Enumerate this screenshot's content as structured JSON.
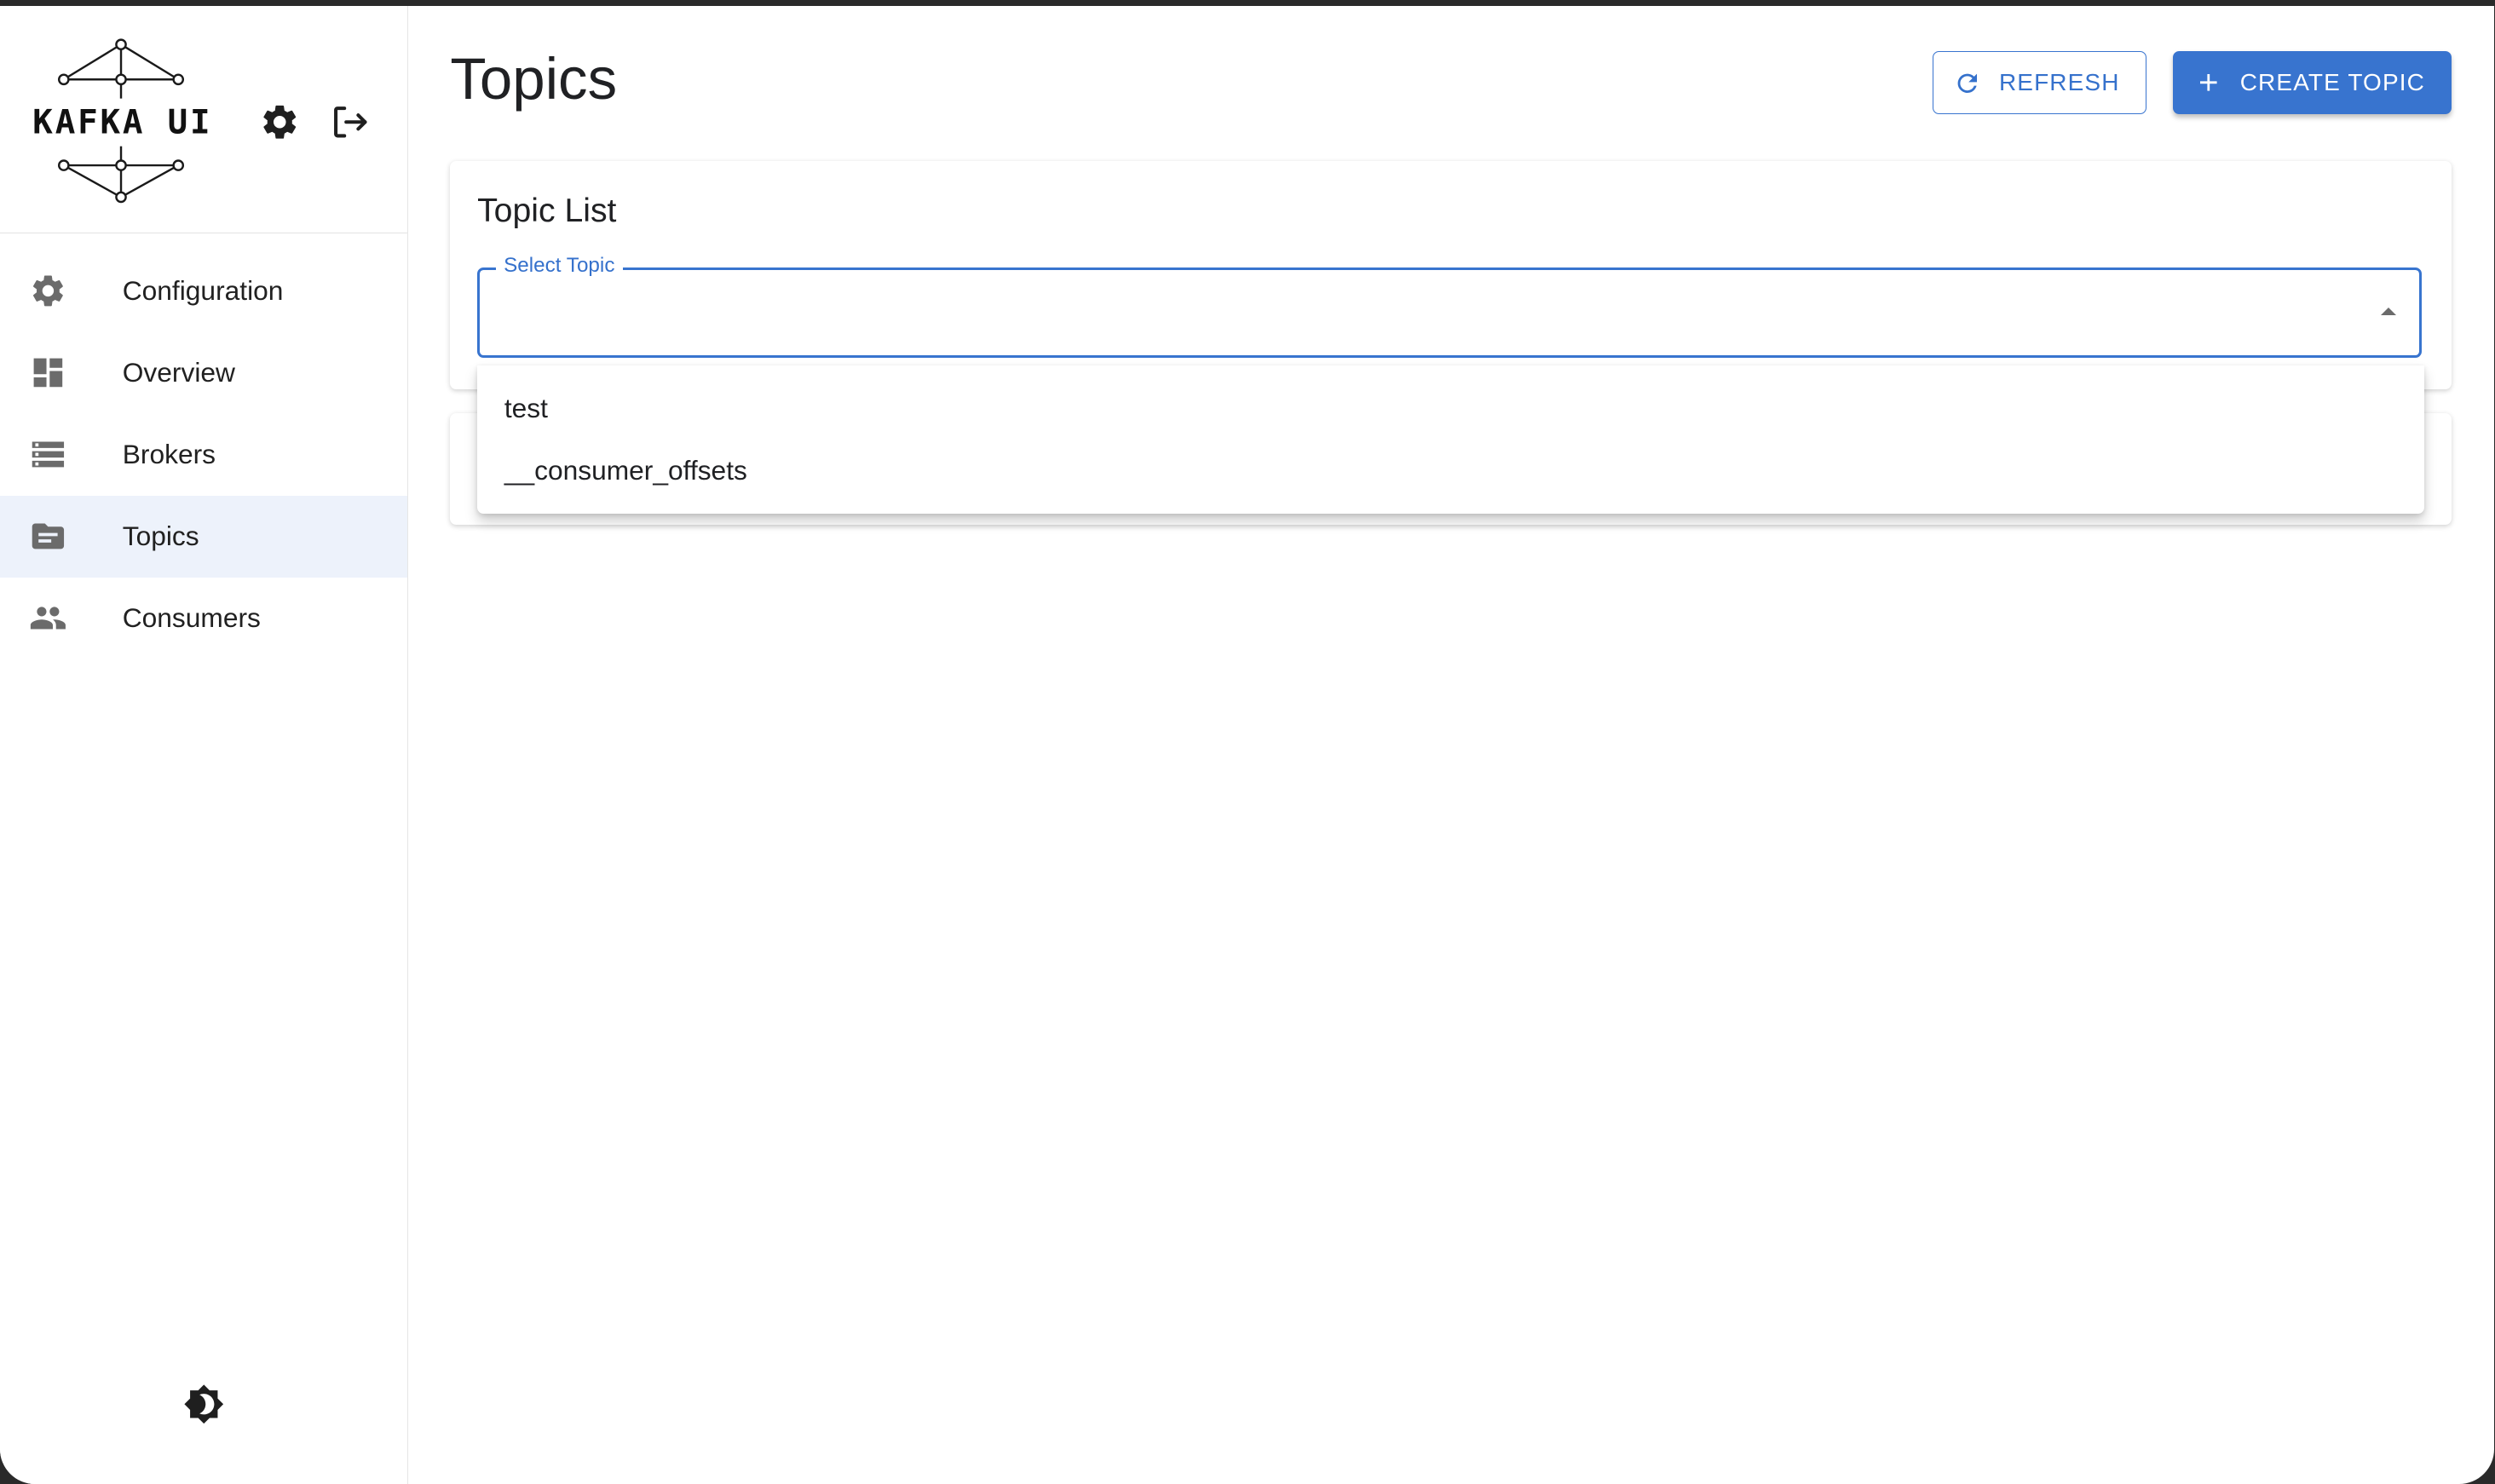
{
  "brand": {
    "logo_text": "KAFKA UI",
    "settings_icon": "gear-icon",
    "logout_icon": "logout-icon"
  },
  "nav": {
    "items": [
      {
        "label": "Configuration",
        "icon": "gear-icon"
      },
      {
        "label": "Overview",
        "icon": "dashboard-icon"
      },
      {
        "label": "Brokers",
        "icon": "list-icon"
      },
      {
        "label": "Topics",
        "icon": "folder-icon",
        "active": true
      },
      {
        "label": "Consumers",
        "icon": "people-icon"
      }
    ]
  },
  "theme_toggle_icon": "brightness-icon",
  "page": {
    "title": "Topics",
    "refresh_label": "REFRESH",
    "create_label": "CREATE TOPIC"
  },
  "topic_list": {
    "title": "Topic List",
    "select_label": "Select Topic",
    "options": [
      "test",
      "__consumer_offsets"
    ]
  },
  "colors": {
    "accent": "#3874cf",
    "active_nav_bg": "#edf2fb"
  }
}
